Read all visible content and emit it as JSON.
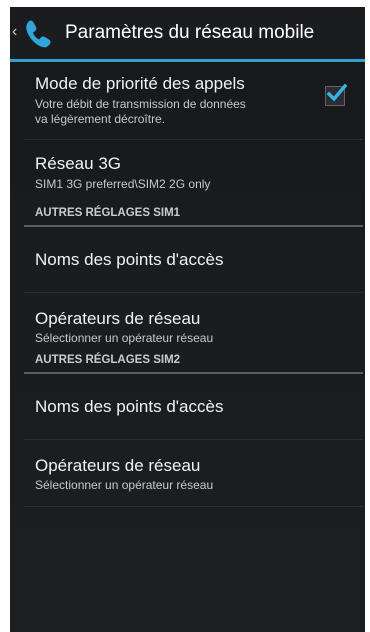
{
  "actionbar": {
    "title": "Paramètres du réseau mobile",
    "up_icon": "chevron-left-icon",
    "app_icon": "phone-handset-icon",
    "accent_color": "#2fa2cf"
  },
  "settings": {
    "call_priority": {
      "title": "Mode de priorité des appels",
      "summary_line1": "Votre débit de transmission de données",
      "summary_line2": "va légèrement décroître.",
      "checked": true
    },
    "network_3g": {
      "title": "Réseau 3G",
      "summary": "SIM1 3G preferred\\SIM2 2G only"
    },
    "sim1_section": {
      "header": "AUTRES RÉGLAGES SIM1",
      "apn_title": "Noms des points d'accès",
      "operators_title": "Opérateurs de réseau",
      "operators_summary": "Sélectionner un opérateur réseau"
    },
    "sim2_section": {
      "header": "AUTRES RÉGLAGES SIM2",
      "apn_title": "Noms des points d'accès",
      "operators_title": "Opérateurs de réseau",
      "operators_summary": "Sélectionner un opérateur réseau"
    }
  }
}
